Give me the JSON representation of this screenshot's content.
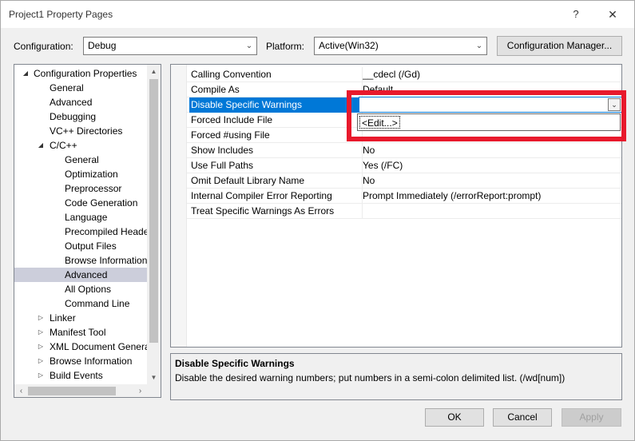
{
  "window": {
    "title": "Project1 Property Pages",
    "help_glyph": "?",
    "close_glyph": "✕"
  },
  "toolbar": {
    "configuration_label": "Configuration:",
    "configuration_value": "Debug",
    "platform_label": "Platform:",
    "platform_value": "Active(Win32)",
    "config_manager_label": "Configuration Manager..."
  },
  "tree": {
    "items": [
      {
        "label": "Configuration Properties",
        "expander": "◢"
      },
      {
        "label": "General"
      },
      {
        "label": "Advanced"
      },
      {
        "label": "Debugging"
      },
      {
        "label": "VC++ Directories"
      },
      {
        "label": "C/C++",
        "expander": "◢"
      },
      {
        "label": "General"
      },
      {
        "label": "Optimization"
      },
      {
        "label": "Preprocessor"
      },
      {
        "label": "Code Generation"
      },
      {
        "label": "Language"
      },
      {
        "label": "Precompiled Heade"
      },
      {
        "label": "Output Files"
      },
      {
        "label": "Browse Information"
      },
      {
        "label": "Advanced"
      },
      {
        "label": "All Options"
      },
      {
        "label": "Command Line"
      },
      {
        "label": "Linker",
        "expander": "▷"
      },
      {
        "label": "Manifest Tool",
        "expander": "▷"
      },
      {
        "label": "XML Document Genera",
        "expander": "▷"
      },
      {
        "label": "Browse Information",
        "expander": "▷"
      },
      {
        "label": "Build Events",
        "expander": "▷"
      }
    ]
  },
  "grid": {
    "rows": [
      {
        "name": "Calling Convention",
        "value": "__cdecl (/Gd)"
      },
      {
        "name": "Compile As",
        "value": "Default"
      },
      {
        "name": "Disable Specific Warnings",
        "value": ""
      },
      {
        "name": "Forced Include File",
        "value": ""
      },
      {
        "name": "Forced #using File",
        "value": ""
      },
      {
        "name": "Show Includes",
        "value": "No"
      },
      {
        "name": "Use Full Paths",
        "value": "Yes (/FC)"
      },
      {
        "name": "Omit Default Library Name",
        "value": "No"
      },
      {
        "name": "Internal Compiler Error Reporting",
        "value": "Prompt Immediately (/errorReport:prompt)"
      },
      {
        "name": "Treat Specific Warnings As Errors",
        "value": ""
      }
    ],
    "dropdown_option": "<Edit...>"
  },
  "description": {
    "title": "Disable Specific Warnings",
    "text": "Disable the desired warning numbers; put numbers in a semi-colon delimited list.     (/wd[num])"
  },
  "buttons": {
    "ok": "OK",
    "cancel": "Cancel",
    "apply": "Apply"
  },
  "colors": {
    "selection": "#0078d7",
    "tree_selection": "#cccedb",
    "annotation_highlight": "#e8192c"
  }
}
